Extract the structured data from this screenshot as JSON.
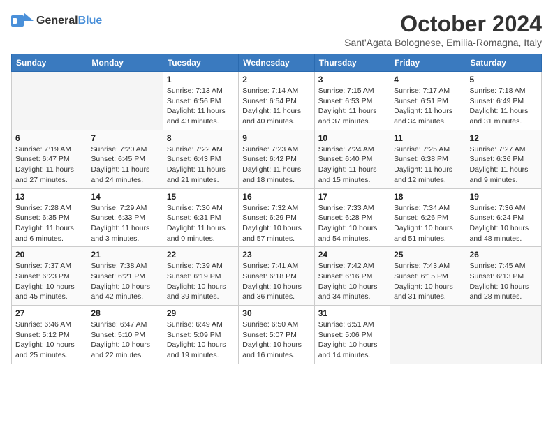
{
  "logo": {
    "general": "General",
    "blue": "Blue"
  },
  "title": "October 2024",
  "location": "Sant'Agata Bolognese, Emilia-Romagna, Italy",
  "weekdays": [
    "Sunday",
    "Monday",
    "Tuesday",
    "Wednesday",
    "Thursday",
    "Friday",
    "Saturday"
  ],
  "weeks": [
    [
      {
        "day": "",
        "info": ""
      },
      {
        "day": "",
        "info": ""
      },
      {
        "day": "1",
        "info": "Sunrise: 7:13 AM\nSunset: 6:56 PM\nDaylight: 11 hours and 43 minutes."
      },
      {
        "day": "2",
        "info": "Sunrise: 7:14 AM\nSunset: 6:54 PM\nDaylight: 11 hours and 40 minutes."
      },
      {
        "day": "3",
        "info": "Sunrise: 7:15 AM\nSunset: 6:53 PM\nDaylight: 11 hours and 37 minutes."
      },
      {
        "day": "4",
        "info": "Sunrise: 7:17 AM\nSunset: 6:51 PM\nDaylight: 11 hours and 34 minutes."
      },
      {
        "day": "5",
        "info": "Sunrise: 7:18 AM\nSunset: 6:49 PM\nDaylight: 11 hours and 31 minutes."
      }
    ],
    [
      {
        "day": "6",
        "info": "Sunrise: 7:19 AM\nSunset: 6:47 PM\nDaylight: 11 hours and 27 minutes."
      },
      {
        "day": "7",
        "info": "Sunrise: 7:20 AM\nSunset: 6:45 PM\nDaylight: 11 hours and 24 minutes."
      },
      {
        "day": "8",
        "info": "Sunrise: 7:22 AM\nSunset: 6:43 PM\nDaylight: 11 hours and 21 minutes."
      },
      {
        "day": "9",
        "info": "Sunrise: 7:23 AM\nSunset: 6:42 PM\nDaylight: 11 hours and 18 minutes."
      },
      {
        "day": "10",
        "info": "Sunrise: 7:24 AM\nSunset: 6:40 PM\nDaylight: 11 hours and 15 minutes."
      },
      {
        "day": "11",
        "info": "Sunrise: 7:25 AM\nSunset: 6:38 PM\nDaylight: 11 hours and 12 minutes."
      },
      {
        "day": "12",
        "info": "Sunrise: 7:27 AM\nSunset: 6:36 PM\nDaylight: 11 hours and 9 minutes."
      }
    ],
    [
      {
        "day": "13",
        "info": "Sunrise: 7:28 AM\nSunset: 6:35 PM\nDaylight: 11 hours and 6 minutes."
      },
      {
        "day": "14",
        "info": "Sunrise: 7:29 AM\nSunset: 6:33 PM\nDaylight: 11 hours and 3 minutes."
      },
      {
        "day": "15",
        "info": "Sunrise: 7:30 AM\nSunset: 6:31 PM\nDaylight: 11 hours and 0 minutes."
      },
      {
        "day": "16",
        "info": "Sunrise: 7:32 AM\nSunset: 6:29 PM\nDaylight: 10 hours and 57 minutes."
      },
      {
        "day": "17",
        "info": "Sunrise: 7:33 AM\nSunset: 6:28 PM\nDaylight: 10 hours and 54 minutes."
      },
      {
        "day": "18",
        "info": "Sunrise: 7:34 AM\nSunset: 6:26 PM\nDaylight: 10 hours and 51 minutes."
      },
      {
        "day": "19",
        "info": "Sunrise: 7:36 AM\nSunset: 6:24 PM\nDaylight: 10 hours and 48 minutes."
      }
    ],
    [
      {
        "day": "20",
        "info": "Sunrise: 7:37 AM\nSunset: 6:23 PM\nDaylight: 10 hours and 45 minutes."
      },
      {
        "day": "21",
        "info": "Sunrise: 7:38 AM\nSunset: 6:21 PM\nDaylight: 10 hours and 42 minutes."
      },
      {
        "day": "22",
        "info": "Sunrise: 7:39 AM\nSunset: 6:19 PM\nDaylight: 10 hours and 39 minutes."
      },
      {
        "day": "23",
        "info": "Sunrise: 7:41 AM\nSunset: 6:18 PM\nDaylight: 10 hours and 36 minutes."
      },
      {
        "day": "24",
        "info": "Sunrise: 7:42 AM\nSunset: 6:16 PM\nDaylight: 10 hours and 34 minutes."
      },
      {
        "day": "25",
        "info": "Sunrise: 7:43 AM\nSunset: 6:15 PM\nDaylight: 10 hours and 31 minutes."
      },
      {
        "day": "26",
        "info": "Sunrise: 7:45 AM\nSunset: 6:13 PM\nDaylight: 10 hours and 28 minutes."
      }
    ],
    [
      {
        "day": "27",
        "info": "Sunrise: 6:46 AM\nSunset: 5:12 PM\nDaylight: 10 hours and 25 minutes."
      },
      {
        "day": "28",
        "info": "Sunrise: 6:47 AM\nSunset: 5:10 PM\nDaylight: 10 hours and 22 minutes."
      },
      {
        "day": "29",
        "info": "Sunrise: 6:49 AM\nSunset: 5:09 PM\nDaylight: 10 hours and 19 minutes."
      },
      {
        "day": "30",
        "info": "Sunrise: 6:50 AM\nSunset: 5:07 PM\nDaylight: 10 hours and 16 minutes."
      },
      {
        "day": "31",
        "info": "Sunrise: 6:51 AM\nSunset: 5:06 PM\nDaylight: 10 hours and 14 minutes."
      },
      {
        "day": "",
        "info": ""
      },
      {
        "day": "",
        "info": ""
      }
    ]
  ]
}
